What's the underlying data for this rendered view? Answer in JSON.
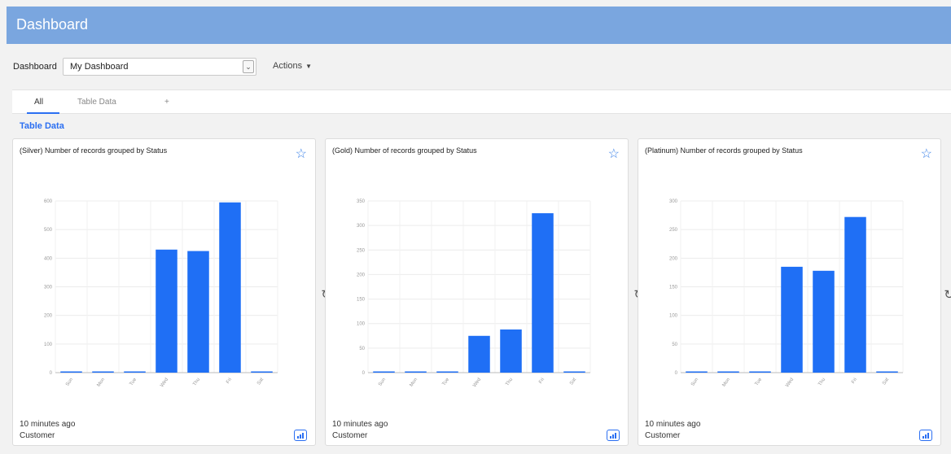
{
  "header": {
    "title": "Dashboard"
  },
  "toolbar": {
    "label": "Dashboard",
    "select_value": "My Dashboard",
    "actions_label": "Actions"
  },
  "tabs": [
    {
      "label": "All"
    },
    {
      "label": "Table Data"
    },
    {
      "label": "+"
    }
  ],
  "section_title": "Table Data",
  "cards": [
    {
      "title": "(Silver) Number of records grouped by Status",
      "updated": "10 minutes ago",
      "owner": "Customer"
    },
    {
      "title": "(Gold) Number of records grouped by Status",
      "updated": "10 minutes ago",
      "owner": "Customer"
    },
    {
      "title": "(Platinum) Number of records grouped by Status",
      "updated": "10 minutes ago",
      "owner": "Customer"
    }
  ],
  "colors": {
    "header": "#7aa6df",
    "bar": "#1f6ff5",
    "accent": "#2b6ff2"
  },
  "chart_data": [
    {
      "type": "bar",
      "categories": [
        "Sun",
        "Mon",
        "Tue",
        "Wed",
        "Thu",
        "Fri",
        "Sat"
      ],
      "values": [
        2,
        2,
        2,
        430,
        425,
        595,
        2
      ],
      "ylim": [
        0,
        600
      ],
      "yticks": [
        0,
        100,
        200,
        300,
        400,
        500,
        600
      ],
      "title": "(Silver) Number of records grouped by Status"
    },
    {
      "type": "bar",
      "categories": [
        "Sun",
        "Mon",
        "Tue",
        "Wed",
        "Thu",
        "Fri",
        "Sat"
      ],
      "values": [
        1,
        1,
        1,
        75,
        88,
        325,
        1
      ],
      "ylim": [
        0,
        350
      ],
      "yticks": [
        0,
        50,
        100,
        150,
        200,
        250,
        300,
        350
      ],
      "title": "(Gold) Number of records grouped by Status"
    },
    {
      "type": "bar",
      "categories": [
        "Sun",
        "Mon",
        "Tue",
        "Wed",
        "Thu",
        "Fri",
        "Sat"
      ],
      "values": [
        1,
        1,
        1,
        185,
        178,
        272,
        1
      ],
      "ylim": [
        0,
        300
      ],
      "yticks": [
        0,
        50,
        100,
        150,
        200,
        250,
        300
      ],
      "title": "(Platinum) Number of records grouped by Status"
    }
  ]
}
